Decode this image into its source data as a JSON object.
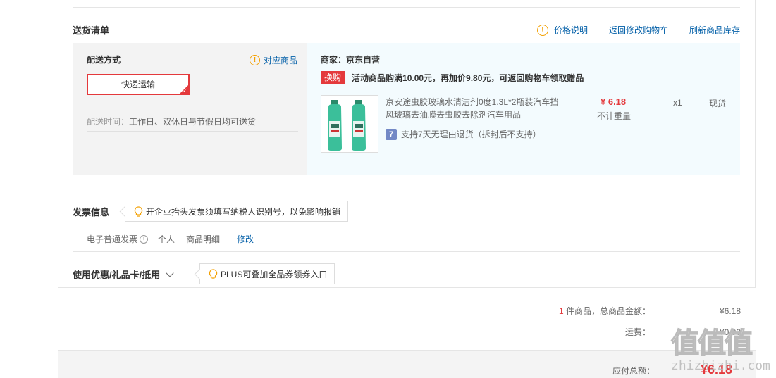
{
  "delivery": {
    "section_title": "送货清单",
    "price_info_label": "价格说明",
    "back_to_cart_label": "返回修改购物车",
    "refresh_stock_label": "刷新商品库存",
    "method_label": "配送方式",
    "corresponding_items_label": "对应商品",
    "method_selected": "快递运输",
    "time_label": "配送时间：",
    "time_value": "工作日、双休日与节假日均可送货"
  },
  "order": {
    "seller": "商家：京东自营",
    "promo_tag": "换购",
    "promo_text": "活动商品购满10.00元，再加价9.80元，可返回购物车领取赠品",
    "product": {
      "name": "京安途虫胶玻璃水清洁剂0度1.3L*2瓶装汽车挡风玻璃去油膜去虫胶去除剂汽车用品",
      "return_badge": "7",
      "return_policy": "支持7天无理由退货（拆封后不支持）",
      "price": "¥ 6.18",
      "weight": "不计重量",
      "quantity": "x1",
      "stock": "现货"
    }
  },
  "invoice": {
    "title": "发票信息",
    "tip": "开企业抬头发票须填写纳税人识别号，以免影响报销",
    "type": "电子普通发票",
    "info_glyph": "!",
    "holder": "个人",
    "content": "商品明细",
    "edit_label": "修改"
  },
  "coupon": {
    "title": "使用优惠/礼品卡/抵用",
    "tip": "PLUS可叠加全品券领券入口"
  },
  "summary": {
    "item_count": "1",
    "items_label": "件商品，总商品金额：",
    "items_value": "¥6.18",
    "freight_label": "运费：",
    "freight_value": "¥0.00",
    "total_label": "应付总额：",
    "total_value": "¥6.18"
  },
  "watermark": {
    "glyphs": "值值值",
    "url": "zhizhizhi.com"
  },
  "colors": {
    "accent_red": "#e4393c",
    "link_blue": "#005ea7",
    "warn_orange": "#f3a001"
  }
}
